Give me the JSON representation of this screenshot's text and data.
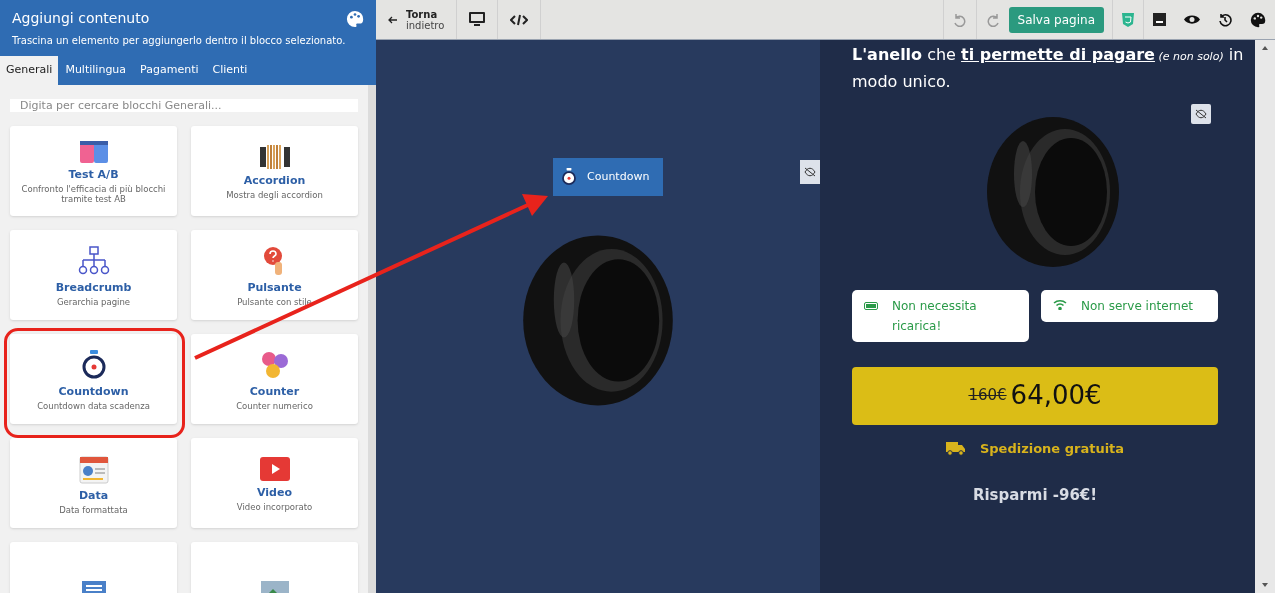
{
  "panel": {
    "title": "Aggiungi contenuto",
    "subtitle": "Trascina un elemento per aggiungerlo dentro il blocco selezionato.",
    "tabs": [
      {
        "label": "Generali",
        "selected": true
      },
      {
        "label": "Multilingua",
        "selected": false
      },
      {
        "label": "Pagamenti",
        "selected": false
      },
      {
        "label": "Clienti",
        "selected": false
      }
    ],
    "search": {
      "placeholder": "Digita per cercare blocchi Generali..."
    },
    "blocks": [
      {
        "kind": "ab",
        "title": "Test A/B",
        "description": "Confronto l'efficacia di più blocchi tramite test AB",
        "highlighted": false
      },
      {
        "kind": "accordion",
        "title": "Accordion",
        "description": "Mostra degli accordion",
        "highlighted": false
      },
      {
        "kind": "breadcrumb",
        "title": "Breadcrumb",
        "description": "Gerarchia pagine",
        "highlighted": false
      },
      {
        "kind": "button",
        "title": "Pulsante",
        "description": "Pulsante con stile",
        "highlighted": false
      },
      {
        "kind": "countdown",
        "title": "Countdown",
        "description": "Countdown data scadenza",
        "highlighted": true
      },
      {
        "kind": "counter",
        "title": "Counter",
        "description": "Counter numerico",
        "highlighted": false
      },
      {
        "kind": "date",
        "title": "Data",
        "description": "Data formattata",
        "highlighted": false
      },
      {
        "kind": "video",
        "title": "Video",
        "description": "Video incorporato",
        "highlighted": false
      },
      {
        "kind": "document",
        "highlighted": false
      },
      {
        "kind": "image",
        "highlighted": false
      }
    ]
  },
  "toolbar": {
    "back_title": "Torna",
    "back_subtitle": "indietro",
    "save": "Salva pagina"
  },
  "canvas": {
    "drag_chip": "Countdown",
    "heading": [
      {
        "kind": "bold",
        "text": "L'anello"
      },
      {
        "kind": "plain",
        "text": " che "
      },
      {
        "kind": "underline",
        "text": "ti permette di pagare"
      },
      {
        "kind": "small",
        "text": " (e non solo)"
      },
      {
        "kind": "plain",
        "text": " in modo unico."
      }
    ],
    "features": [
      {
        "kind": "battery",
        "text": "Non necessita ricarica!"
      },
      {
        "kind": "wifi",
        "text": "Non serve internet"
      }
    ],
    "old_price": "160€",
    "price": "64,00€",
    "shipping": "Spedizione gratuita",
    "savings": "Risparmi -96€!"
  }
}
